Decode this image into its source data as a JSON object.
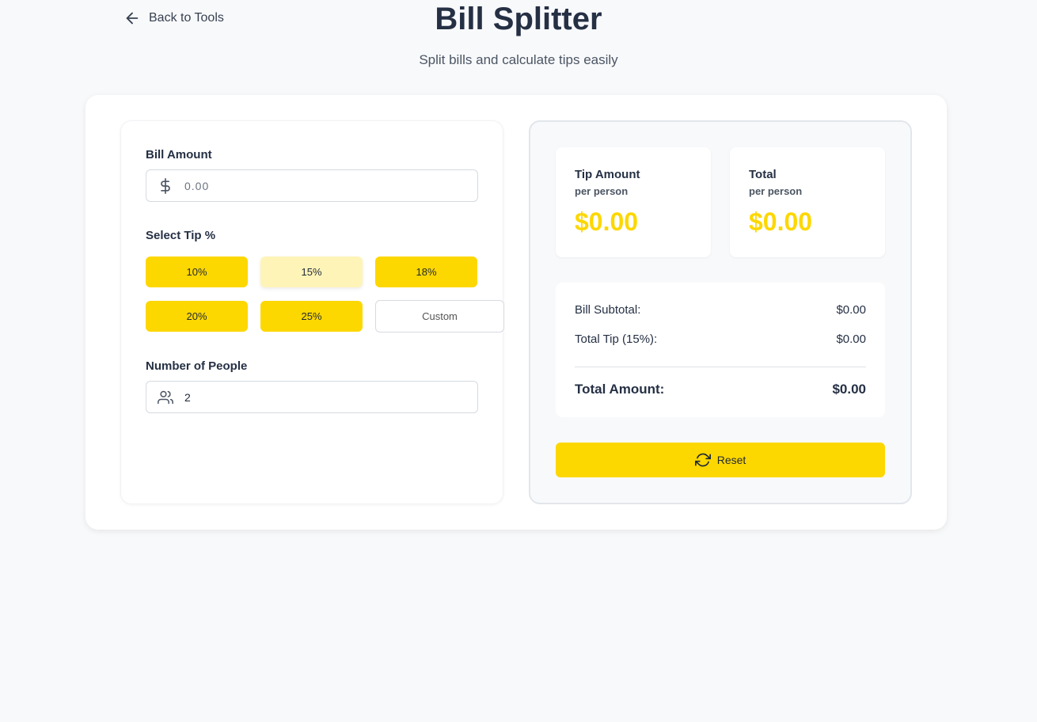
{
  "nav": {
    "back_label": "Back to Tools"
  },
  "header": {
    "title": "Bill Splitter",
    "subtitle": "Split bills and calculate tips easily"
  },
  "form": {
    "bill_label": "Bill Amount",
    "bill_placeholder": "0.00",
    "tip_label": "Select Tip %",
    "tips": [
      {
        "label": "10%",
        "selected": false
      },
      {
        "label": "15%",
        "selected": true
      },
      {
        "label": "18%",
        "selected": false
      },
      {
        "label": "20%",
        "selected": false
      },
      {
        "label": "25%",
        "selected": false
      }
    ],
    "custom_placeholder": "Custom",
    "people_label": "Number of People",
    "people_value": "2"
  },
  "results": {
    "tip_card": {
      "title": "Tip Amount",
      "sub": "per person",
      "value": "$0.00"
    },
    "total_card": {
      "title": "Total",
      "sub": "per person",
      "value": "$0.00"
    },
    "summary": {
      "subtotal_label": "Bill Subtotal:",
      "subtotal_value": "$0.00",
      "tip_label": "Total Tip (15%):",
      "tip_value": "$0.00",
      "total_label": "Total Amount:",
      "total_value": "$0.00"
    },
    "reset_label": "Reset"
  },
  "colors": {
    "accent": "#fdd700",
    "selected_tip": "#fff4b8",
    "text_dark": "#253044"
  },
  "icons": {
    "back": "arrow-left-icon",
    "dollar": "dollar-icon",
    "people": "users-icon",
    "reset": "refresh-icon"
  }
}
